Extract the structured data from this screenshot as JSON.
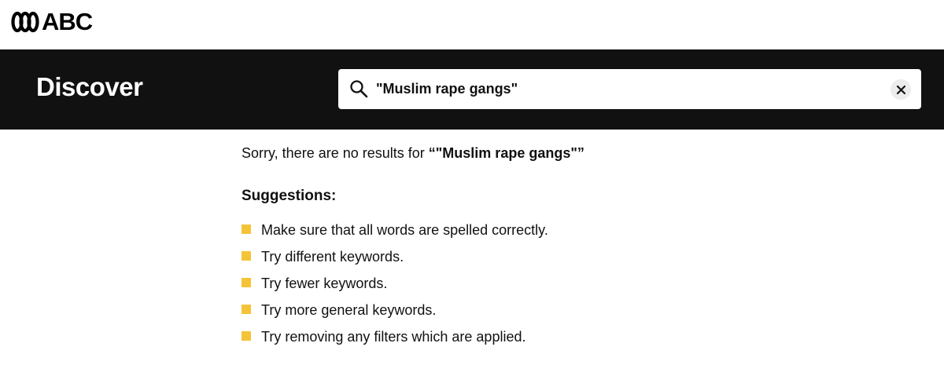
{
  "brand": {
    "logo_text": "ABC",
    "icon": "abc-lissajous-logo-icon"
  },
  "header": {
    "title": "Discover",
    "background_color": "#111111"
  },
  "search": {
    "value": "\"Muslim rape gangs\"",
    "icon": "search-icon",
    "clear_icon": "close-icon"
  },
  "results": {
    "message_prefix": "Sorry, there are no results for ",
    "open_quote": "“",
    "query": "\"Muslim rape gangs\"",
    "close_quote": "”"
  },
  "suggestions": {
    "heading": "Suggestions:",
    "bullet_color": "#f5c338",
    "items": [
      "Make sure that all words are spelled correctly.",
      "Try different keywords.",
      "Try fewer keywords.",
      "Try more general keywords.",
      "Try removing any filters which are applied."
    ]
  }
}
